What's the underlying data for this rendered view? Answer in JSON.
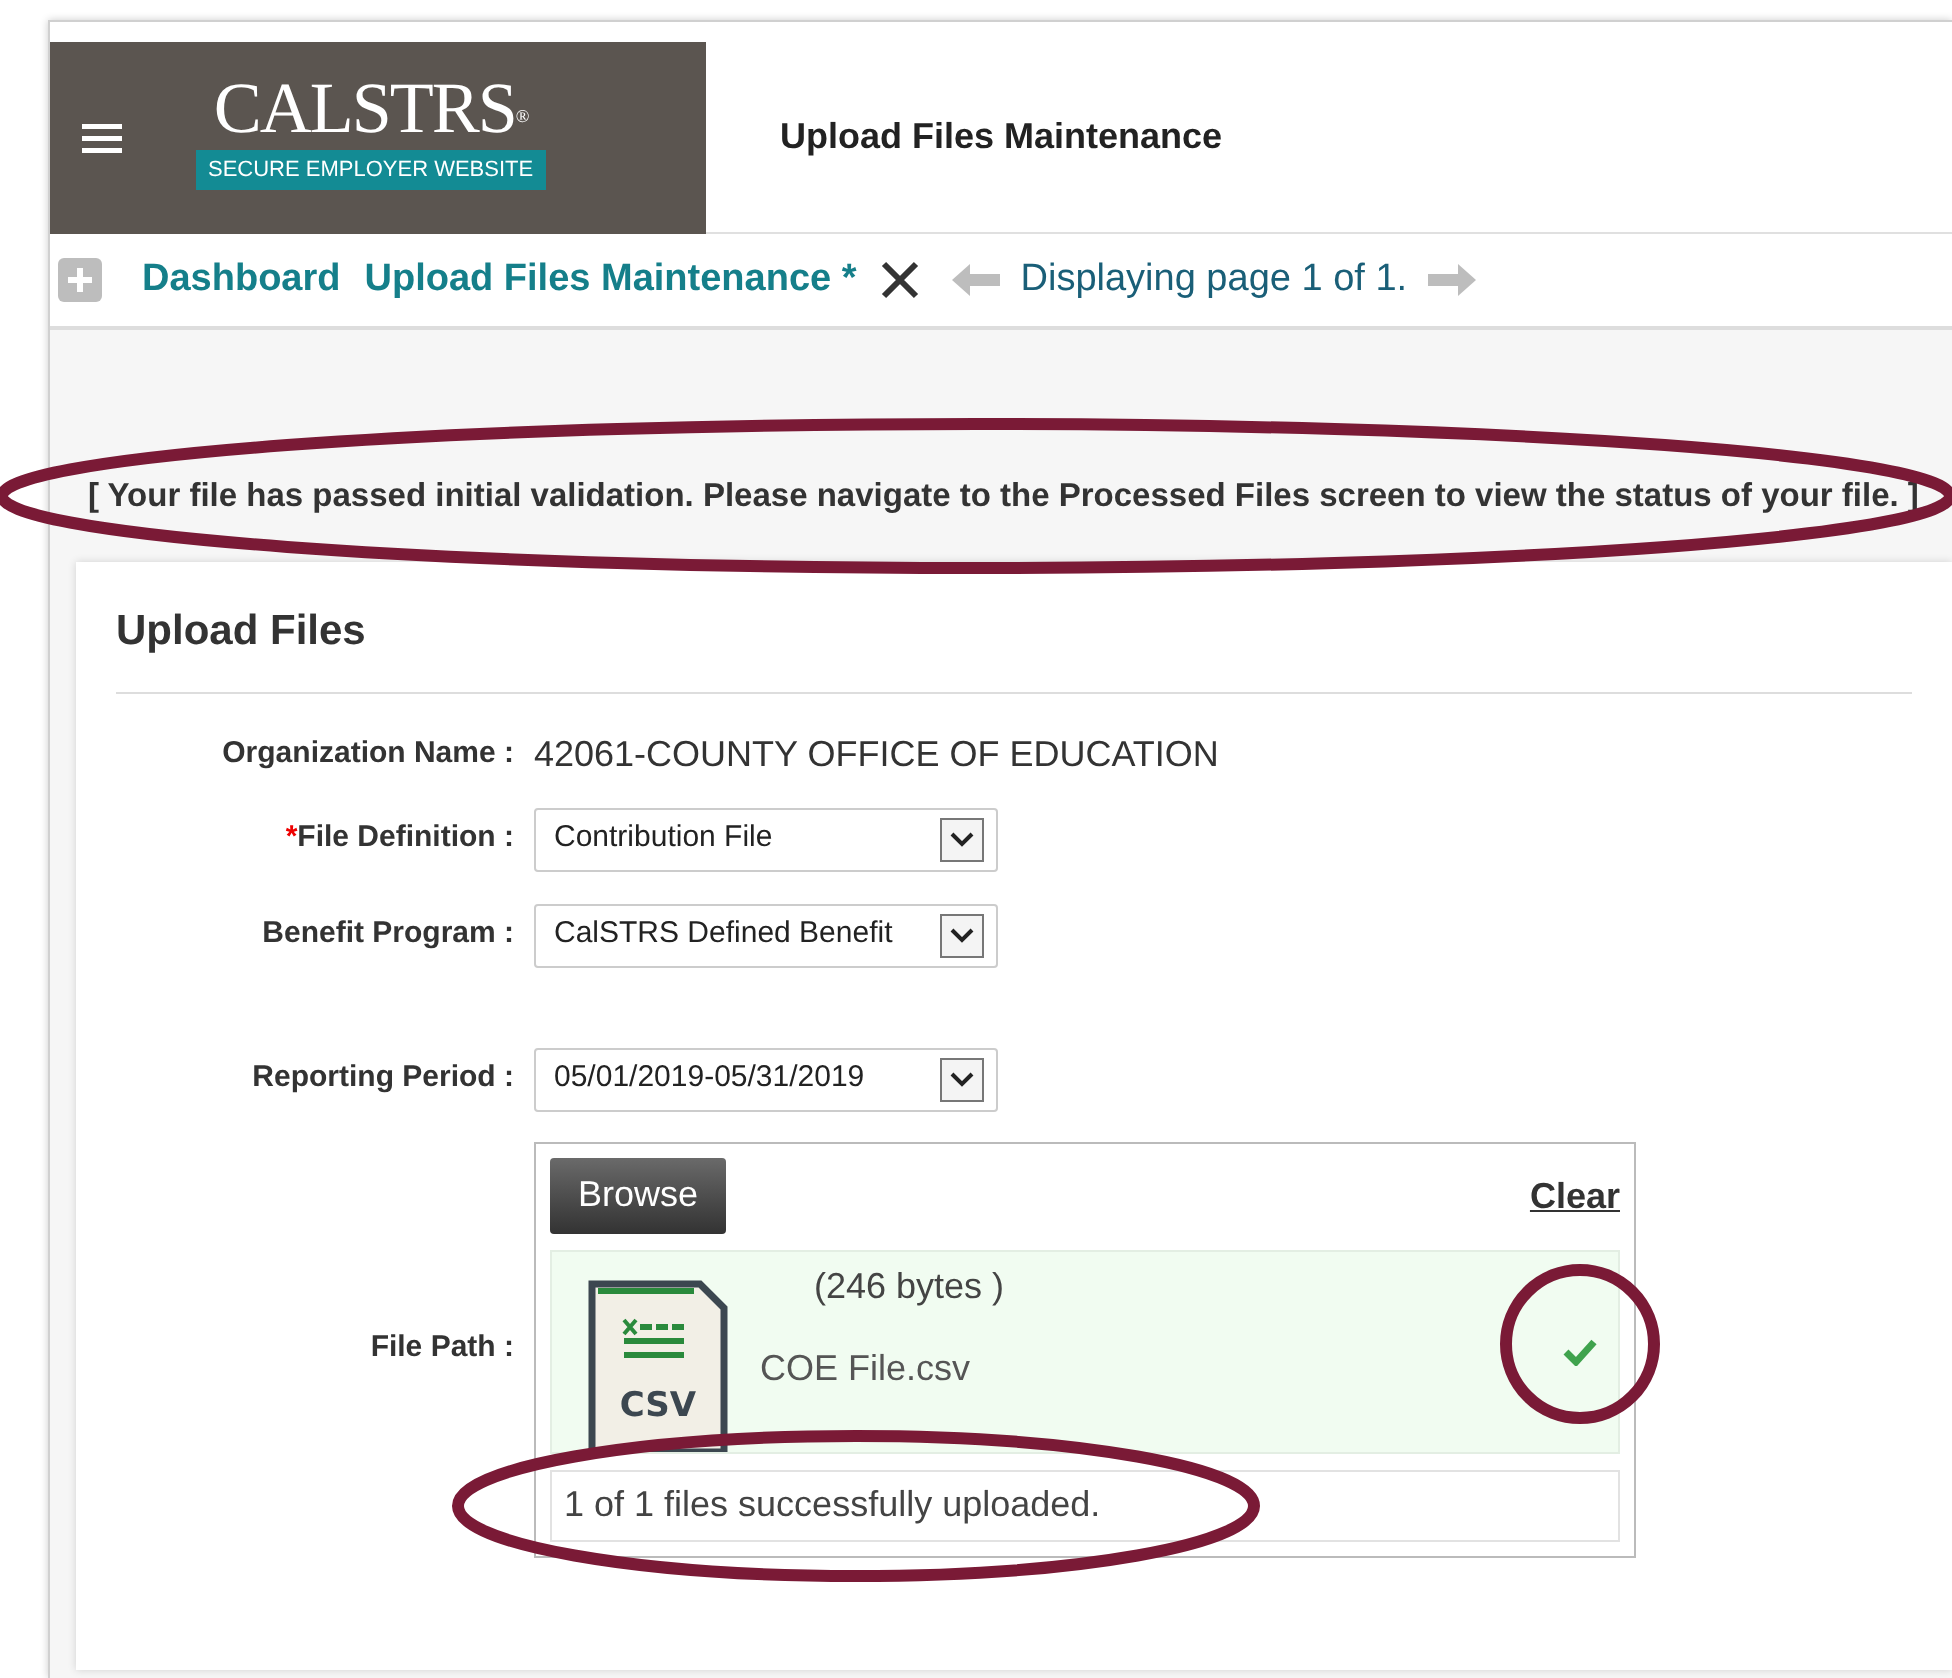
{
  "header": {
    "logo": {
      "name": "CALSTRS",
      "mark": "®",
      "tagline": "SECURE EMPLOYER WEBSITE"
    },
    "title": "Upload Files Maintenance"
  },
  "tabs": [
    {
      "label": "Dashboard"
    },
    {
      "label": "Upload Files Maintenance *",
      "closable": true
    }
  ],
  "pager": {
    "text": "Displaying page 1 of 1."
  },
  "message": "[ Your file has passed initial validation. Please navigate to the Processed Files screen to view the status of your file. ]",
  "card": {
    "title": "Upload Files",
    "fields": [
      {
        "kind": "text",
        "label": "Organization Name :",
        "value": "42061-COUNTY OFFICE OF EDUCATION"
      },
      {
        "kind": "select",
        "required_mark": "*",
        "label": "File Definition :",
        "value": "Contribution File"
      },
      {
        "kind": "select",
        "label": "Benefit Program :",
        "value": "CalSTRS Defined Benefit"
      },
      {
        "kind": "select",
        "label": "Reporting Period :",
        "value": "05/01/2019-05/31/2019"
      }
    ],
    "file_path": {
      "label": "File Path :",
      "browse": "Browse",
      "clear": "Clear",
      "file": {
        "size": "(246 bytes )",
        "name": "COE File.csv",
        "type": "CSV",
        "uploaded": true
      },
      "status": "1 of 1 files successfully uploaded."
    }
  }
}
